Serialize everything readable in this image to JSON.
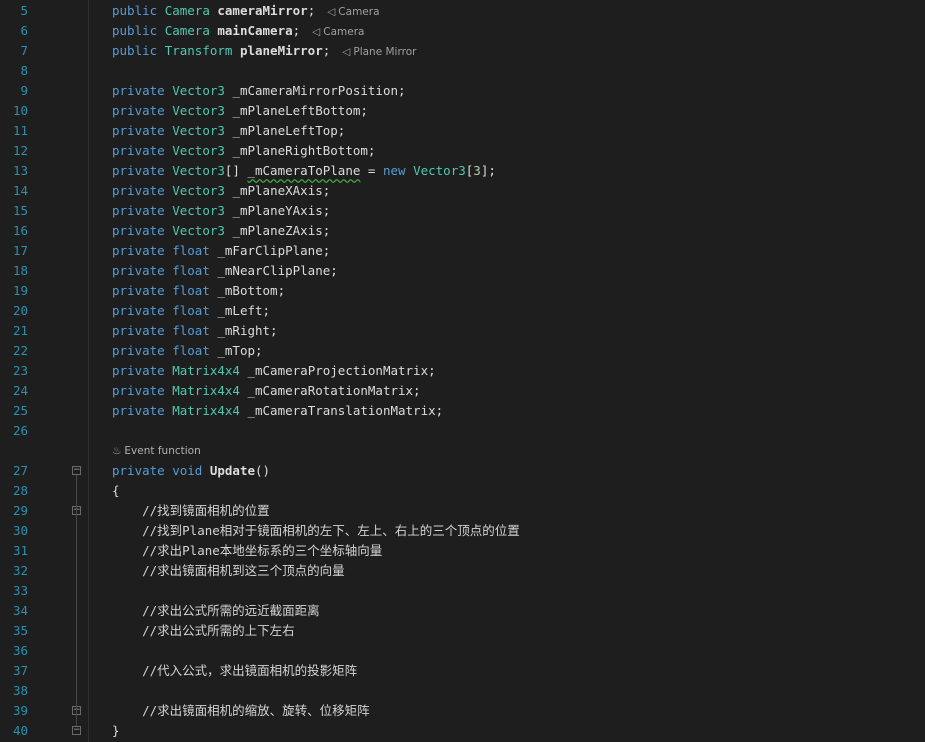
{
  "editor": {
    "lines": [
      {
        "n": "5",
        "tokens": [
          [
            "kw",
            "public "
          ],
          [
            "type",
            "Camera "
          ],
          [
            "bold",
            "cameraMirror"
          ],
          [
            "ident",
            ";"
          ]
        ],
        "hint": {
          "icon": "unity-asset-icon",
          "text": "Camera"
        }
      },
      {
        "n": "6",
        "tokens": [
          [
            "kw",
            "public "
          ],
          [
            "type",
            "Camera "
          ],
          [
            "bold",
            "mainCamera"
          ],
          [
            "ident",
            ";"
          ]
        ],
        "hint": {
          "icon": "unity-asset-icon",
          "text": "Camera"
        }
      },
      {
        "n": "7",
        "tokens": [
          [
            "kw",
            "public "
          ],
          [
            "type",
            "Transform "
          ],
          [
            "bold",
            "planeMirror"
          ],
          [
            "ident",
            ";"
          ]
        ],
        "hint": {
          "icon": "unity-asset-icon",
          "text": "Plane Mirror"
        }
      },
      {
        "n": "8",
        "tokens": []
      },
      {
        "n": "9",
        "tokens": [
          [
            "kw",
            "private "
          ],
          [
            "type",
            "Vector3 "
          ],
          [
            "ident",
            "_mCameraMirrorPosition;"
          ]
        ]
      },
      {
        "n": "10",
        "tokens": [
          [
            "kw",
            "private "
          ],
          [
            "type",
            "Vector3 "
          ],
          [
            "ident",
            "_mPlaneLeftBottom;"
          ]
        ]
      },
      {
        "n": "11",
        "tokens": [
          [
            "kw",
            "private "
          ],
          [
            "type",
            "Vector3 "
          ],
          [
            "ident",
            "_mPlaneLeftTop;"
          ]
        ]
      },
      {
        "n": "12",
        "tokens": [
          [
            "kw",
            "private "
          ],
          [
            "type",
            "Vector3 "
          ],
          [
            "ident",
            "_mPlaneRightBottom;"
          ]
        ]
      },
      {
        "n": "13",
        "tokens": [
          [
            "kw",
            "private "
          ],
          [
            "type",
            "Vector3"
          ],
          [
            "ident",
            "[] "
          ],
          [
            "squiggle",
            "_mCameraToPlane"
          ],
          [
            "ident",
            " = "
          ],
          [
            "kw",
            "new "
          ],
          [
            "type",
            "Vector3"
          ],
          [
            "ident",
            "["
          ],
          [
            "num",
            "3"
          ],
          [
            "ident",
            "];"
          ]
        ]
      },
      {
        "n": "14",
        "tokens": [
          [
            "kw",
            "private "
          ],
          [
            "type",
            "Vector3 "
          ],
          [
            "ident",
            "_mPlaneXAxis;"
          ]
        ]
      },
      {
        "n": "15",
        "tokens": [
          [
            "kw",
            "private "
          ],
          [
            "type",
            "Vector3 "
          ],
          [
            "ident",
            "_mPlaneYAxis;"
          ]
        ]
      },
      {
        "n": "16",
        "tokens": [
          [
            "kw",
            "private "
          ],
          [
            "type",
            "Vector3 "
          ],
          [
            "ident",
            "_mPlaneZAxis;"
          ]
        ]
      },
      {
        "n": "17",
        "tokens": [
          [
            "kw",
            "private "
          ],
          [
            "kw",
            "float "
          ],
          [
            "ident",
            "_mFarClipPlane;"
          ]
        ]
      },
      {
        "n": "18",
        "tokens": [
          [
            "kw",
            "private "
          ],
          [
            "kw",
            "float "
          ],
          [
            "ident",
            "_mNearClipPlane;"
          ]
        ]
      },
      {
        "n": "19",
        "tokens": [
          [
            "kw",
            "private "
          ],
          [
            "kw",
            "float "
          ],
          [
            "ident",
            "_mBottom;"
          ]
        ]
      },
      {
        "n": "20",
        "tokens": [
          [
            "kw",
            "private "
          ],
          [
            "kw",
            "float "
          ],
          [
            "ident",
            "_mLeft;"
          ]
        ]
      },
      {
        "n": "21",
        "tokens": [
          [
            "kw",
            "private "
          ],
          [
            "kw",
            "float "
          ],
          [
            "ident",
            "_mRight;"
          ]
        ]
      },
      {
        "n": "22",
        "tokens": [
          [
            "kw",
            "private "
          ],
          [
            "kw",
            "float "
          ],
          [
            "ident",
            "_mTop;"
          ]
        ]
      },
      {
        "n": "23",
        "tokens": [
          [
            "kw",
            "private "
          ],
          [
            "type",
            "Matrix4x4 "
          ],
          [
            "ident",
            "_mCameraProjectionMatrix;"
          ]
        ]
      },
      {
        "n": "24",
        "tokens": [
          [
            "kw",
            "private "
          ],
          [
            "type",
            "Matrix4x4 "
          ],
          [
            "ident",
            "_mCameraRotationMatrix;"
          ]
        ]
      },
      {
        "n": "25",
        "tokens": [
          [
            "kw",
            "private "
          ],
          [
            "type",
            "Matrix4x4 "
          ],
          [
            "ident",
            "_mCameraTranslationMatrix;"
          ]
        ]
      },
      {
        "n": "26",
        "tokens": []
      },
      {
        "n": "27",
        "tokens": [
          [
            "kw",
            "private "
          ],
          [
            "kw",
            "void "
          ],
          [
            "bold",
            "Update"
          ],
          [
            "ident",
            "()"
          ]
        ],
        "fold": true,
        "codelens": {
          "icon": "unity-event-icon",
          "text": "Event function"
        }
      },
      {
        "n": "28",
        "tokens": [
          [
            "ident",
            "{"
          ]
        ]
      },
      {
        "n": "29",
        "tokens": [
          [
            "comment",
            "    //找到镜面相机的位置"
          ]
        ],
        "fold": true
      },
      {
        "n": "30",
        "tokens": [
          [
            "comment",
            "    //找到Plane相对于镜面相机的左下、左上、右上的三个顶点的位置"
          ]
        ]
      },
      {
        "n": "31",
        "tokens": [
          [
            "comment",
            "    //求出Plane本地坐标系的三个坐标轴向量"
          ]
        ]
      },
      {
        "n": "32",
        "tokens": [
          [
            "comment",
            "    //求出镜面相机到这三个顶点的向量"
          ]
        ]
      },
      {
        "n": "33",
        "tokens": []
      },
      {
        "n": "34",
        "tokens": [
          [
            "comment",
            "    //求出公式所需的远近截面距离"
          ]
        ]
      },
      {
        "n": "35",
        "tokens": [
          [
            "comment",
            "    //求出公式所需的上下左右"
          ]
        ]
      },
      {
        "n": "36",
        "tokens": []
      },
      {
        "n": "37",
        "tokens": [
          [
            "comment",
            "    //代入公式，求出镜面相机的投影矩阵"
          ]
        ]
      },
      {
        "n": "38",
        "tokens": []
      },
      {
        "n": "39",
        "tokens": [
          [
            "comment",
            "    //求出镜面相机的缩放、旋转、位移矩阵"
          ]
        ],
        "fold": true
      },
      {
        "n": "40",
        "tokens": [
          [
            "ident",
            "}"
          ]
        ],
        "fold": true
      }
    ]
  },
  "colors": {
    "background": "#1e1e1e",
    "line_number": "#2b91af",
    "keyword": "#569cd6",
    "type": "#4ec9b0",
    "number": "#b5cea8"
  }
}
